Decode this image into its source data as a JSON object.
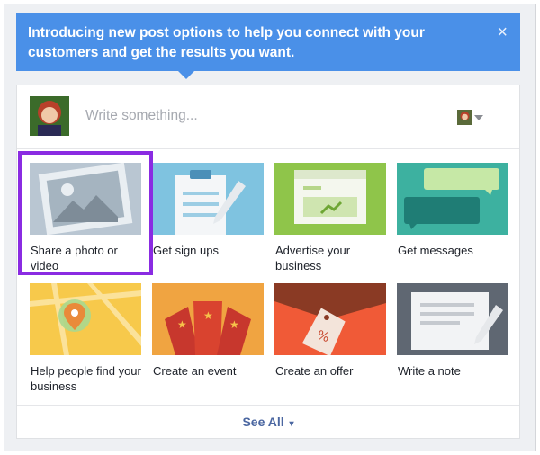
{
  "banner": {
    "text": "Introducing new post options to help you connect with your customers and get the results you want.",
    "close_label": "×"
  },
  "composer": {
    "placeholder": "Write something..."
  },
  "options": [
    {
      "label": "Share a photo or video",
      "icon": "photo-icon",
      "selected": true
    },
    {
      "label": "Get sign ups",
      "icon": "clipboard-icon"
    },
    {
      "label": "Advertise your business",
      "icon": "advertise-icon"
    },
    {
      "label": "Get messages",
      "icon": "messages-icon"
    },
    {
      "label": "Help people find your business",
      "icon": "map-pin-icon"
    },
    {
      "label": "Create an event",
      "icon": "event-tickets-icon"
    },
    {
      "label": "Create an offer",
      "icon": "offer-tag-icon"
    },
    {
      "label": "Write a note",
      "icon": "note-icon"
    }
  ],
  "footer": {
    "see_all": "See All"
  },
  "colors": {
    "banner": "#4a90e8",
    "selection": "#8a2be2",
    "link": "#4b67a1"
  }
}
